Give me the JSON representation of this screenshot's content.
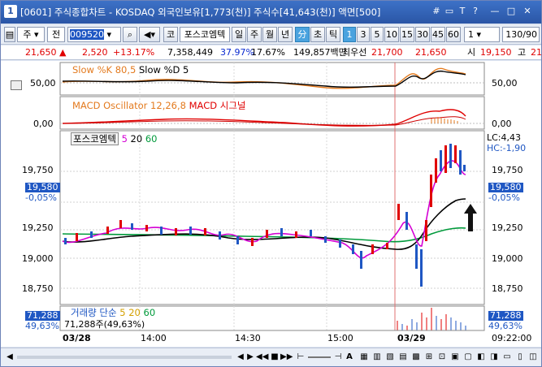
{
  "title": {
    "app_icon": "1",
    "text": "[0601] 주식종합차트 - KOSDAQ 외국인보유[1,773(천)] 주식수[41,643(천)] 액면[500]",
    "controls": [
      "#",
      "▭",
      "T",
      "?",
      "—",
      "□",
      "✕"
    ]
  },
  "toolbar": {
    "market": "주",
    "period_field": "전",
    "code": "009520",
    "code_btn": "코",
    "stock_name": "포스코엠텍",
    "period_buttons": [
      "일",
      "주",
      "월",
      "년",
      "分",
      "초",
      "틱"
    ],
    "interval_buttons": [
      "1",
      "3",
      "5",
      "10",
      "15",
      "30",
      "45",
      "60"
    ],
    "selected_interval": "1",
    "count_select": "1",
    "range": "130/90"
  },
  "pricebar": {
    "price": "21,650",
    "arrow": "▲",
    "change": "2,520",
    "change_pct": "+13.17%",
    "volume": "7,358,449",
    "ratio1": "37.97%",
    "ratio2": "17.67%",
    "amount": "149,857백만",
    "best_label": "최우선",
    "best_ask": "21,700",
    "best_bid": "21,650",
    "open_label": "시",
    "open": "19,150",
    "high_label": "고",
    "high": "21"
  },
  "stochastic": {
    "label_k": "Slow %K 80,5",
    "label_d": "Slow %D 5",
    "axis": "50,00",
    "axis_right": "50,00"
  },
  "macd": {
    "label": "MACD Oscillator 12,26,8",
    "label2": "MACD",
    "label3": "시그널",
    "axis": "0,00",
    "axis_right": "0,00"
  },
  "price_chart": {
    "legend_name": "포스코엠텍",
    "ma": [
      "5",
      "20",
      "60"
    ],
    "lc": "LC:4,43",
    "hc": "HC:-1,90",
    "y_ticks": [
      "19,750",
      "19,500",
      "19,250",
      "19,000",
      "18,750"
    ],
    "current_price": "19,580",
    "current_pct": "-0,05%"
  },
  "volume_chart": {
    "label": "거래량",
    "type": "단순",
    "ma": [
      "5",
      "20",
      "60"
    ],
    "current_value": "71,288주(49,63%)",
    "axis_value": "71,288",
    "axis_pct": "49,63%"
  },
  "x_axis": {
    "labels": [
      "03/28",
      "14:00",
      "14:30",
      "15:00",
      "03/29"
    ],
    "time": "09:22:00"
  },
  "colors": {
    "candle_up": "#e00000",
    "candle_down": "#1f57c3",
    "ma5": "#d400d4",
    "ma20": "#000000",
    "ma60": "#009a3b",
    "stoch_k": "#e37a1e",
    "stoch_d": "#000000",
    "macd_osc": "#e37a1e",
    "macd": "#e00000",
    "signal": "#cc0000"
  },
  "statusbar": {
    "buttons": [
      "◀",
      "▶",
      "◀◀",
      "■",
      "▶▶",
      "⊢",
      "⊣",
      "A"
    ]
  }
}
